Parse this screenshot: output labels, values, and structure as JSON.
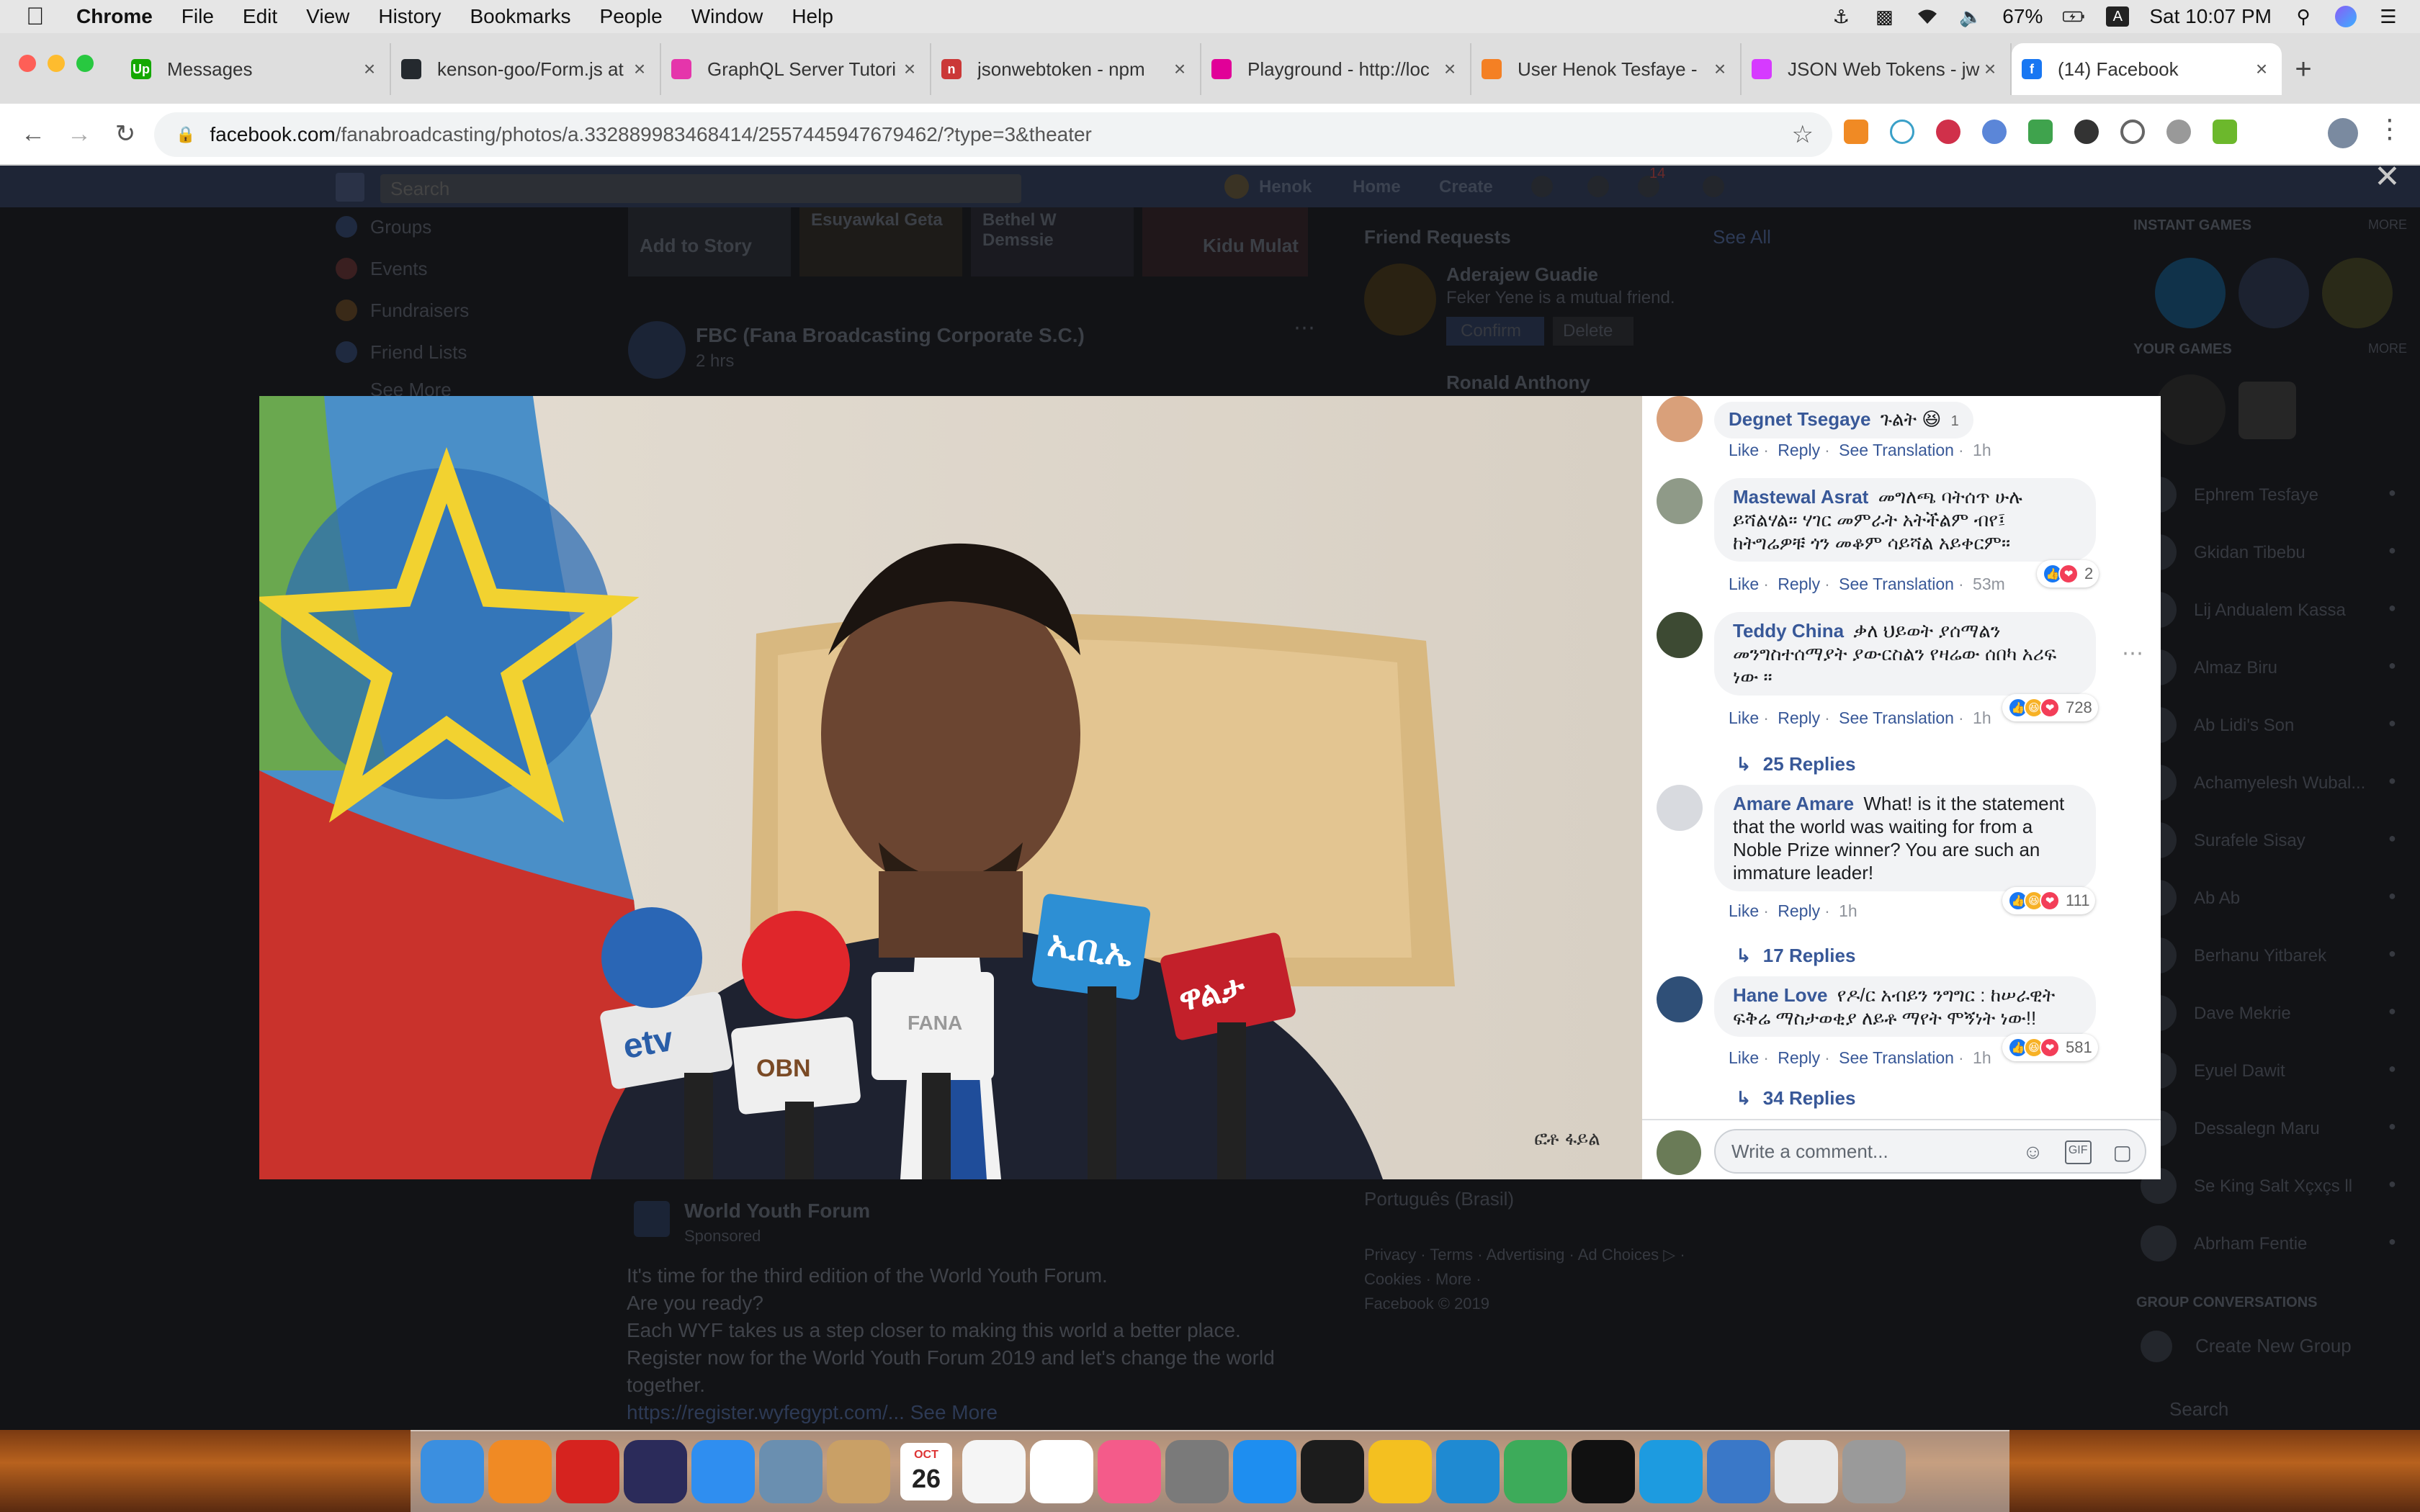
{
  "menubar": {
    "app_name": "Chrome",
    "items": [
      "File",
      "Edit",
      "View",
      "History",
      "Bookmarks",
      "People",
      "Window",
      "Help"
    ],
    "battery": "67%",
    "clock": "Sat 10:07 PM"
  },
  "tabs": [
    {
      "title": "Messages",
      "favicon_color": "#14a800",
      "favicon_text": "Up"
    },
    {
      "title": "kenson-goo/Form.js at",
      "favicon_color": "#24292e",
      "favicon_text": ""
    },
    {
      "title": "GraphQL Server Tutori",
      "favicon_color": "#e535ab",
      "favicon_text": ""
    },
    {
      "title": "jsonwebtoken - npm",
      "favicon_color": "#cb3837",
      "favicon_text": "n"
    },
    {
      "title": "Playground - http://loc",
      "favicon_color": "#e10098",
      "favicon_text": ""
    },
    {
      "title": "User Henok Tesfaye -",
      "favicon_color": "#f48024",
      "favicon_text": ""
    },
    {
      "title": "JSON Web Tokens - jw",
      "favicon_color": "#d63aff",
      "favicon_text": ""
    },
    {
      "title": "(14) Facebook",
      "favicon_color": "#1877f2",
      "favicon_text": "f"
    }
  ],
  "toolbar": {
    "url_host": "facebook.com",
    "url_path": "/fanabroadcasting/photos/a.332889983468414/2557445947679462/?type=3&theater"
  },
  "fb_background": {
    "search_placeholder": "Search",
    "nav": {
      "user": "Henok",
      "home": "Home",
      "create": "Create",
      "notif_count": "14"
    },
    "left_menu": [
      "Groups",
      "Events",
      "Fundraisers",
      "Friend Lists",
      "See More"
    ],
    "stories": [
      "Add to Story",
      "Esuyawkal Geta",
      "Bethel W Demssie",
      "Kidu Mulat"
    ],
    "post": {
      "page": "FBC (Fana Broadcasting Corporate S.C.)",
      "time": "2 hrs"
    },
    "friend_requests": {
      "heading": "Friend Requests",
      "see_all": "See All",
      "name1": "Aderajew Guadie",
      "mutual": "Feker Yene is a mutual friend.",
      "confirm": "Confirm",
      "delete": "Delete",
      "name2": "Ronald Anthony"
    },
    "ad": {
      "title": "World Youth Forum",
      "sponsored": "Sponsored",
      "line1": "It's time for the third edition of the World Youth Forum.",
      "line2": "Are you ready?",
      "line3": "Each WYF takes us a step closer to making this world a better place.",
      "line4": "Register now for the World Youth Forum 2019 and let's change the world",
      "line5": "together.",
      "link": "https://register.wyfegypt.com/... See More"
    },
    "footer": {
      "lang": "Português (Brasil)",
      "links": "Privacy · Terms · Advertising · Ad Choices ▷ ·",
      "links2": "Cookies · More ·",
      "copyright": "Facebook © 2019"
    },
    "sidebar": {
      "instant_games": "INSTANT GAMES",
      "your_games": "YOUR GAMES",
      "more": "MORE",
      "contacts": [
        "Ephrem Tesfaye",
        "Gkidan Tibebu",
        "Lij Andualem Kassa",
        "Almaz Biru",
        "Ab Lidi's Son",
        "Achamyelesh Wubal...",
        "Surafele Sisay",
        "Ab Ab",
        "Berhanu Yitbarek",
        "Dave Mekrie",
        "Eyuel Dawit",
        "Dessalegn Maru",
        "Se King Salt Xçxçs ll",
        "Abrham Fentie"
      ],
      "group_conversations": "GROUP CONVERSATIONS",
      "create_group": "Create New Group",
      "chat_search": "Search"
    }
  },
  "photo": {
    "watermark": "ፎቶ ፋይል",
    "mic_labels": [
      "etv",
      "OBN",
      "FANA",
      "ኢቢኤ",
      "ዋልታ"
    ]
  },
  "comments": [
    {
      "author": "Degnet Tsegaye",
      "text": "ጉልት",
      "react_count": "1",
      "actions": {
        "like": "Like",
        "reply": "Reply",
        "translate": "See Translation",
        "time": "1h"
      },
      "avatar_color": "#d9a07a"
    },
    {
      "author": "Mastewal Asrat",
      "text": "መግለጫ ባትሰጥ ሁሉ ይሻልሃል። ሃገር መምራት አትችልም ብየ፤ ከትግሬዎቹ ጎን መቆም ሳይሻል አይቀርም።",
      "react_count": "2",
      "actions": {
        "like": "Like",
        "reply": "Reply",
        "translate": "See Translation",
        "time": "53m"
      },
      "avatar_color": "#8f9a88"
    },
    {
      "author": "Teddy China",
      "text": "ቃለ ህይወት ያሰማልን መንግስተሰማያት ያውርስልን የዛሬው ሰበካ አሪፍ ነው ።",
      "react_count": "728",
      "actions": {
        "like": "Like",
        "reply": "Reply",
        "translate": "See Translation",
        "time": "1h"
      },
      "replies": "25 Replies",
      "avatar_color": "#3d4a33"
    },
    {
      "author": "Amare Amare",
      "text": "What! is it the statement that the world was waiting for from a Noble Prize winner? You are such an immature leader!",
      "react_count": "111",
      "actions": {
        "like": "Like",
        "reply": "Reply",
        "time": "1h"
      },
      "replies": "17 Replies",
      "avatar_color": "#d8dadf"
    },
    {
      "author": "Hane Love",
      "text": "የዶ/ር አብይን ንግግር : ከሠራዊት ፍቅሬ ማስታወቂያ ለይቶ ማየት ሞኝነት ነው!!",
      "react_count": "581",
      "actions": {
        "like": "Like",
        "reply": "Reply",
        "translate": "See Translation",
        "time": "1h"
      },
      "replies": "34 Replies",
      "avatar_color": "#2f4f77"
    }
  ],
  "write_comment": {
    "placeholder": "Write a comment...",
    "gif": "GIF"
  },
  "dock": {
    "calendar_month": "OCT",
    "calendar_day": "26",
    "apps": [
      "Finder",
      "Books",
      "Acrobat",
      "Siri",
      "Safari",
      "Preview",
      "Notes",
      "Stickies",
      "Reminders",
      "Photos",
      "Music",
      "System Preferences",
      "App Store",
      "Terminal",
      "Chrome",
      "VS Code",
      "Android Studio",
      "IntelliJ",
      "Docker",
      "Migration",
      "Documents",
      "Trash"
    ]
  },
  "colors": {
    "fb_link": "#385898",
    "fb_blue": "#1877f2",
    "comment_bg": "#f2f3f5"
  }
}
